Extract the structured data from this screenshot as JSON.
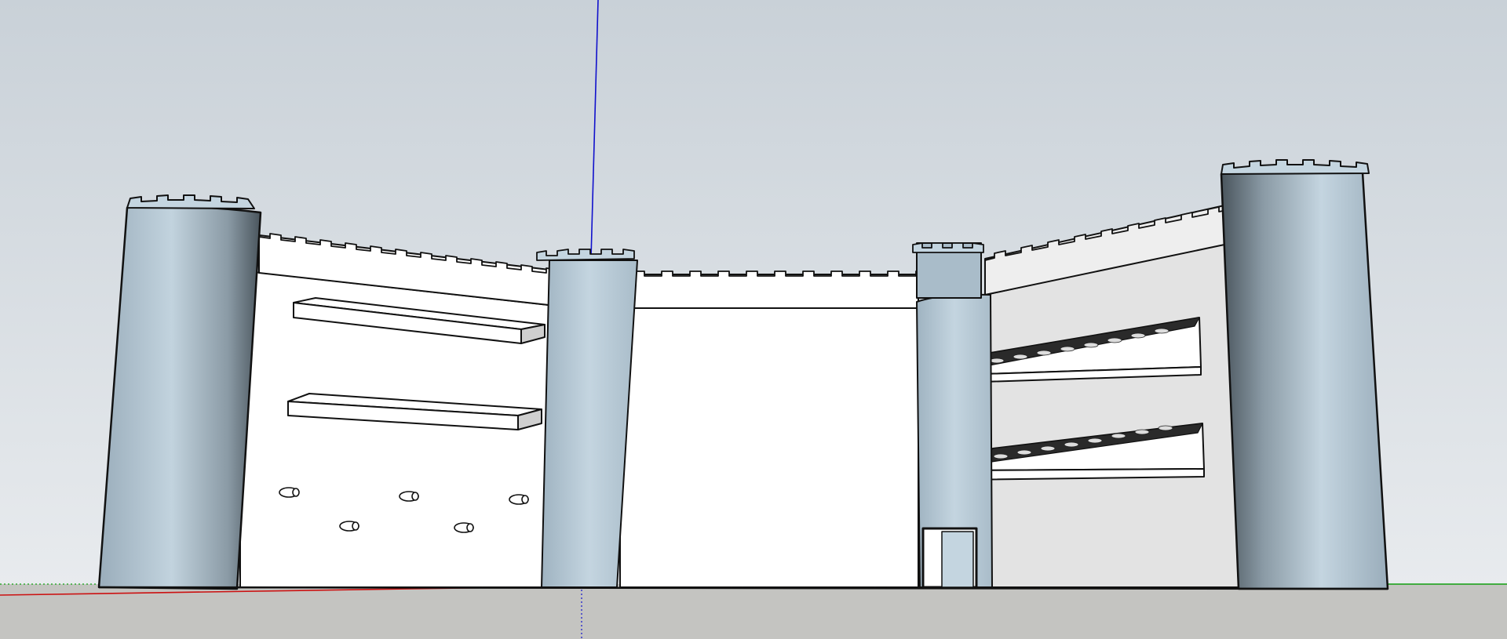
{
  "app": {
    "type": "3d-modeling-viewport"
  },
  "scene": {
    "model": "castle-with-towers",
    "sky_top": "#c9d1d8",
    "sky_bottom": "#e6e9ec",
    "ground": "#c4c4c1",
    "wall_face": "#ffffff",
    "wall_shade": "#e3e3e3",
    "tower_light": "#c4d4df",
    "tower_dark": "#4e5a62",
    "edge": "#111111"
  },
  "axes": {
    "red": "#cc1111",
    "green": "#11a011",
    "blue": "#1111cc"
  }
}
